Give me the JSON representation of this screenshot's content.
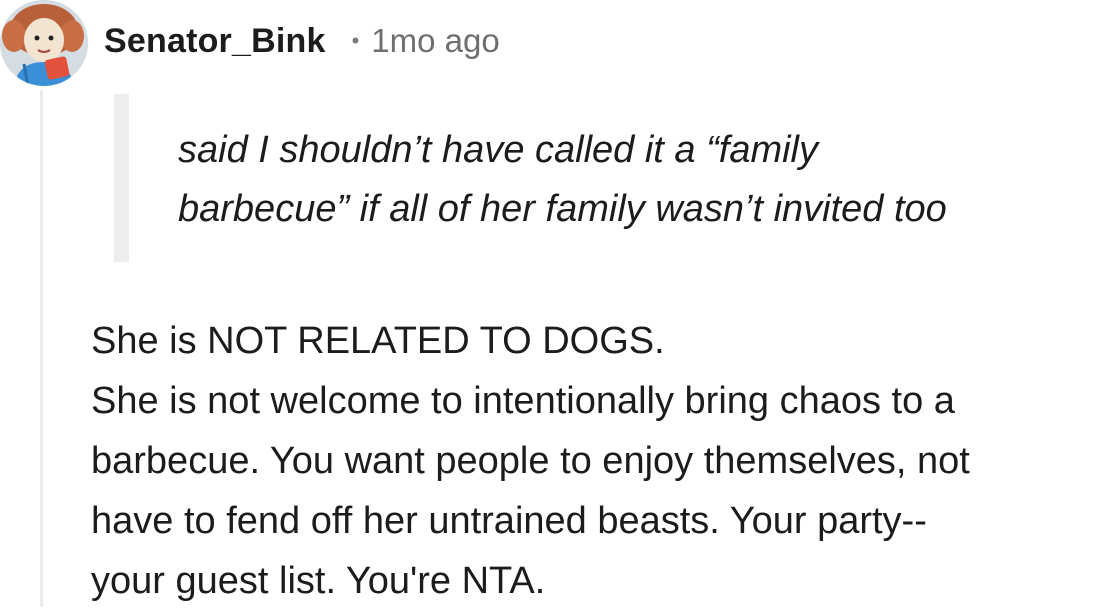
{
  "comment": {
    "author": "Senator_Bink",
    "separator": "•",
    "timestamp": "1mo ago",
    "quote_lines": [
      "said I shouldn’t have called it a “family",
      "barbecue” if all of her family wasn’t invited too"
    ],
    "body_lines": [
      "She is NOT RELATED TO DOGS.",
      "She is not welcome to intentionally bring chaos to a",
      "barbecue. You want people to enjoy themselves, not",
      "have to fend off her untrained beasts. Your party--",
      "your guest list. You're NTA."
    ],
    "avatar_icon": "user-avatar-icon"
  },
  "colors": {
    "text": "#1c1c1c",
    "meta": "#6f6f6f",
    "quote_bar": "#ededed",
    "thread_line": "#e9ecee"
  }
}
